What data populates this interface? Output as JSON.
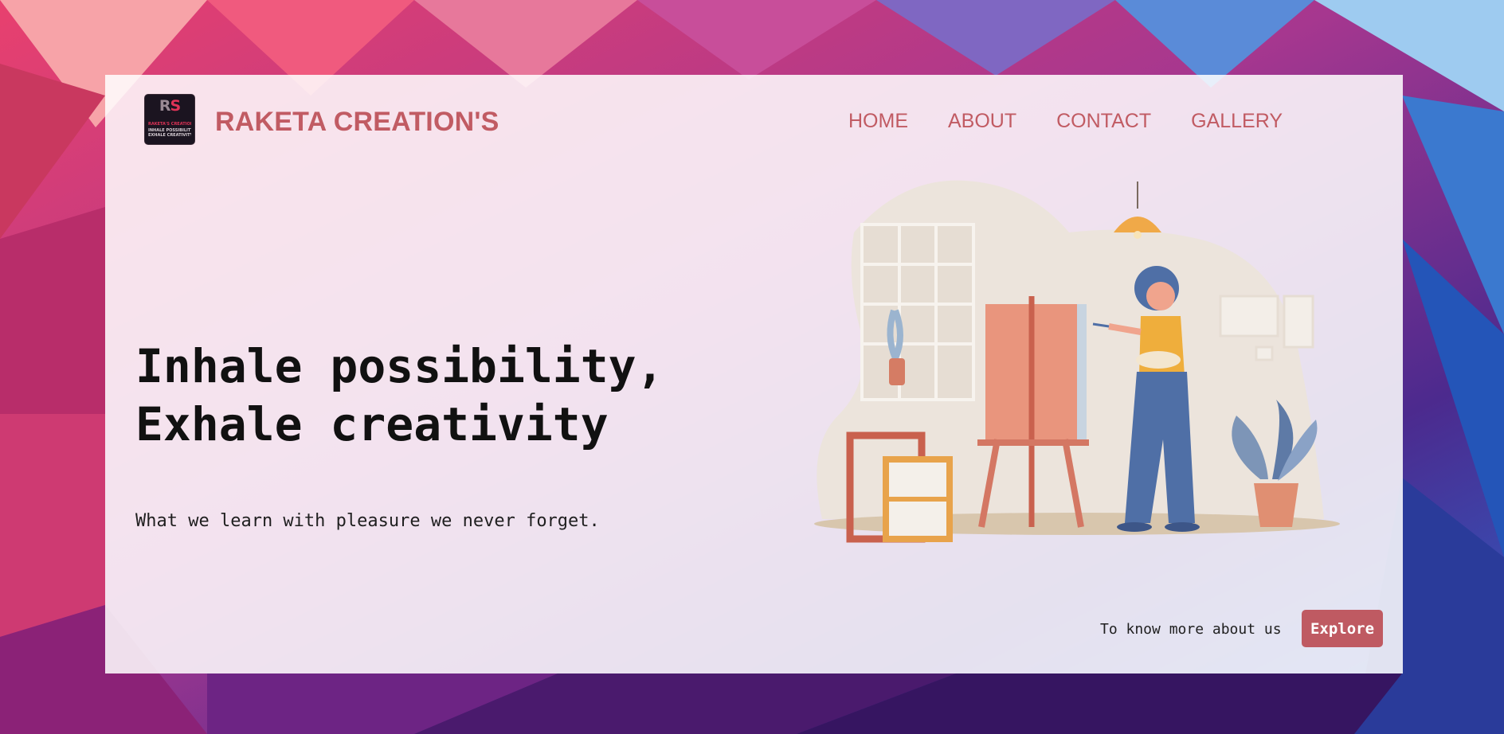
{
  "brand": {
    "name": "RAKETA CREATION'S",
    "logo_monogram_r": "R",
    "logo_monogram_s": "S",
    "logo_line1": "RAKETA'S CREATION",
    "logo_line2": "INHALE POSSIBILITY",
    "logo_line3": "EXHALE CREATIVITY"
  },
  "nav": [
    {
      "label": "HOME"
    },
    {
      "label": "ABOUT"
    },
    {
      "label": "CONTACT"
    },
    {
      "label": "GALLERY"
    }
  ],
  "hero": {
    "headline_line1": "Inhale possibility,",
    "headline_line2": "Exhale creativity",
    "tagline": "What we learn with pleasure we never forget."
  },
  "cta": {
    "prompt": "To know more about us",
    "button_label": "Explore"
  },
  "colors": {
    "accent": "#c15b63",
    "button": "#bf5a62",
    "text_dark": "#111111"
  },
  "icons": {
    "illustration": "artist-painting-at-easel-illustration"
  }
}
